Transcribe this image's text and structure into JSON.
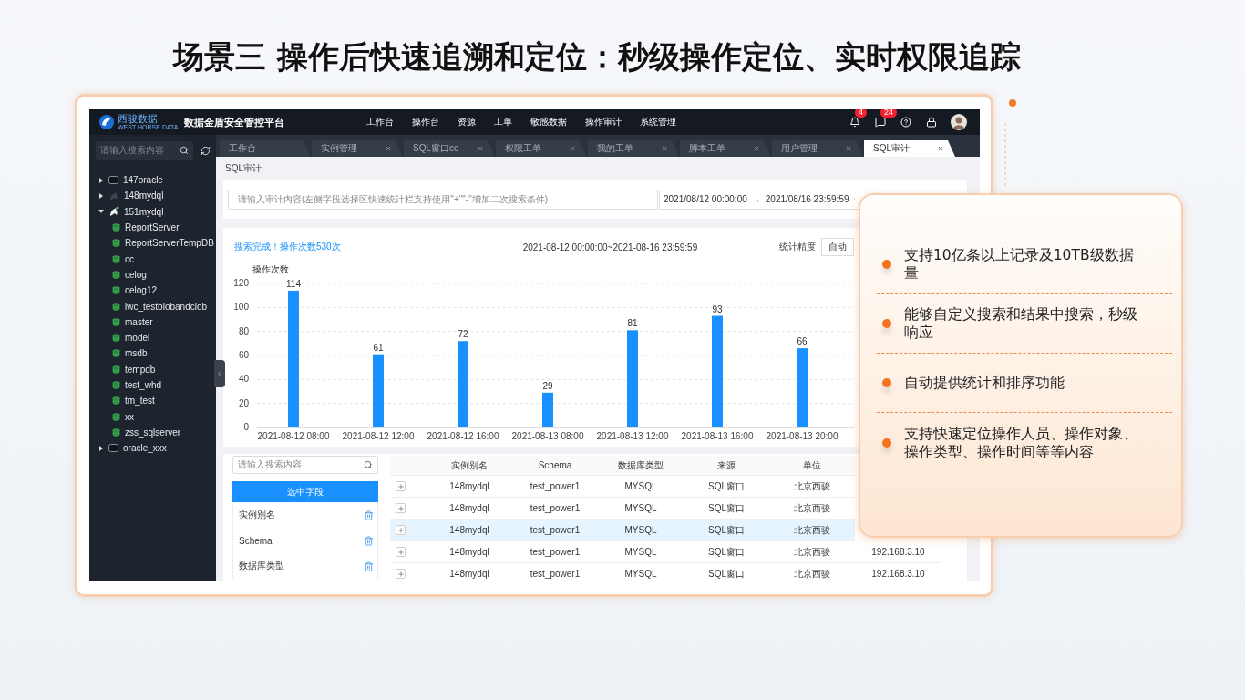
{
  "title": "场景三 操作后快速追溯和定位：秒级操作定位、实时权限追踪",
  "app": {
    "logo": {
      "name": "西骏数据",
      "tagline": "WEST HORSE DATA"
    },
    "product": "数据金盾安全管控平台",
    "nav": [
      {
        "label": "工作台"
      },
      {
        "label": "操作台"
      },
      {
        "label": "资源"
      },
      {
        "label": "工单"
      },
      {
        "label": "敏感数据"
      },
      {
        "label": "操作审计"
      },
      {
        "label": "系统管理"
      }
    ],
    "header_icons": [
      {
        "kind": "bell",
        "badge": "4"
      },
      {
        "kind": "message",
        "badge": "24"
      },
      {
        "kind": "help"
      },
      {
        "kind": "lock"
      },
      {
        "kind": "avatar"
      }
    ],
    "sidebar": {
      "search": {
        "placeholder": "请输入搜索内容"
      },
      "tree": [
        {
          "label": "147oracle",
          "kind": "oracle",
          "expanded": false,
          "connected": false
        },
        {
          "label": "148mydql",
          "kind": "mysql",
          "expanded": false,
          "connected": false
        },
        {
          "label": "151mydql",
          "kind": "mysql",
          "expanded": true,
          "connected": true,
          "children": [
            {
              "label": "ReportServer",
              "kind": "database"
            },
            {
              "label": "ReportServerTempDB",
              "kind": "database"
            },
            {
              "label": "cc",
              "kind": "database"
            },
            {
              "label": "celog",
              "kind": "database"
            },
            {
              "label": "celog12",
              "kind": "database"
            },
            {
              "label": "lwc_testblobandclob",
              "kind": "database"
            },
            {
              "label": "master",
              "kind": "database"
            },
            {
              "label": "model",
              "kind": "database"
            },
            {
              "label": "msdb",
              "kind": "database"
            },
            {
              "label": "tempdb",
              "kind": "database"
            },
            {
              "label": "test_whd",
              "kind": "database"
            },
            {
              "label": "tm_test",
              "kind": "database"
            },
            {
              "label": "xx",
              "kind": "database"
            },
            {
              "label": "zss_sqlserver",
              "kind": "database"
            }
          ]
        },
        {
          "label": "oracle_xxx",
          "kind": "oracle",
          "expanded": false,
          "connected": false
        }
      ]
    },
    "tabs": [
      {
        "label": "工作台",
        "closable": false,
        "selected": false
      },
      {
        "label": "实例管理",
        "closable": true,
        "selected": false
      },
      {
        "label": "SQL窗口cc",
        "closable": true,
        "selected": false
      },
      {
        "label": "权限工单",
        "closable": true,
        "selected": false
      },
      {
        "label": "我的工单",
        "closable": true,
        "selected": false
      },
      {
        "label": "脚本工单",
        "closable": true,
        "selected": false
      },
      {
        "label": "用户管理",
        "closable": true,
        "selected": false
      },
      {
        "label": "SQL审计",
        "closable": true,
        "selected": true
      }
    ],
    "breadcrumb": "SQL审计",
    "search": {
      "placeholder": "请输入审计内容(左侧字段选择区快速统计栏支持使用\"+\"\"-\"增加二次搜索条件)",
      "start": "2021/08/12 00:00:00",
      "separator": "→",
      "end": "2021/08/16 23:59:59"
    },
    "summary": {
      "status": "搜索完成！操作次数530次",
      "range": "2021-08-12 00:00:00~2021-08-16 23:59:59",
      "precision_label": "统计精度",
      "precision_value": "自动"
    },
    "chart_data": {
      "type": "bar",
      "ylabel": "操作次数",
      "categories": [
        "2021-08-12 08:00",
        "2021-08-12 12:00",
        "2021-08-12 16:00",
        "2021-08-13 08:00",
        "2021-08-13 12:00",
        "2021-08-13 16:00",
        "2021-08-13 20:00"
      ],
      "series": [
        {
          "color": "#1890ff",
          "values": [
            114,
            61,
            72,
            29,
            81,
            93,
            66
          ]
        }
      ],
      "ylim": [
        0,
        120
      ],
      "yticks": [
        0,
        20,
        40,
        60,
        80,
        100,
        120
      ],
      "grid": true,
      "data_labels": true
    },
    "fields": {
      "placeholder": "请输入搜索内容",
      "header": "选中字段",
      "items": [
        "实例别名",
        "Schema",
        "数据库类型"
      ]
    },
    "table": {
      "columns": [
        "实例别名",
        "Schema",
        "数据库类型",
        "来源",
        "单位"
      ],
      "rows": [
        {
          "cells": [
            "148mydql",
            "test_power1",
            "MYSQL",
            "SQL窗口",
            "北京西骏"
          ],
          "selected": false
        },
        {
          "cells": [
            "148mydql",
            "test_power1",
            "MYSQL",
            "SQL窗口",
            "北京西骏"
          ],
          "selected": false
        },
        {
          "cells": [
            "148mydql",
            "test_power1",
            "MYSQL",
            "SQL窗口",
            "北京西骏"
          ],
          "selected": true
        },
        {
          "cells": [
            "148mydql",
            "test_power1",
            "MYSQL",
            "SQL窗口",
            "北京西骏"
          ],
          "column_6": "192.168.3.10",
          "selected": false
        },
        {
          "cells": [
            "148mydql",
            "test_power1",
            "MYSQL",
            "SQL窗口",
            "北京西骏"
          ],
          "column_6": "192.168.3.10",
          "selected": false
        }
      ]
    }
  },
  "callout": {
    "points": [
      "支持10亿条以上记录及10TB级数据量",
      "能够自定义搜索和结果中搜索，秒级响应",
      "自动提供统计和排序功能",
      "支持快速定位操作人员、操作对象、操作类型、操作时间等等内容"
    ]
  }
}
